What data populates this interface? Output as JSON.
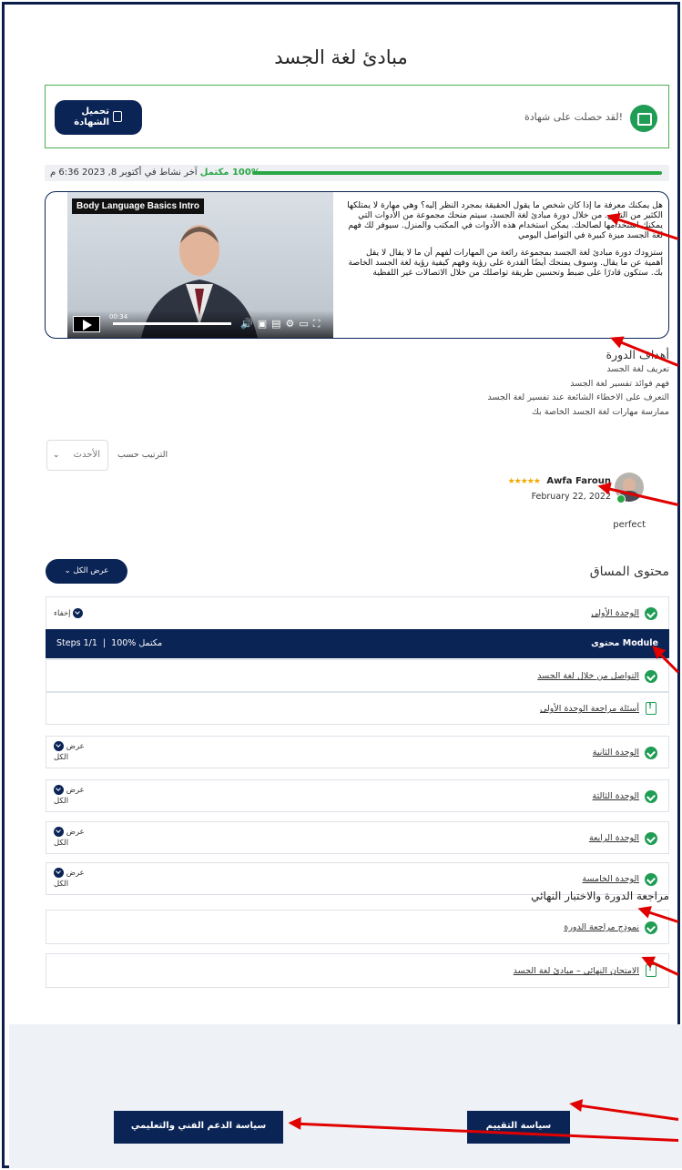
{
  "page": {
    "title": "مبادئ لغة الجسد"
  },
  "certificate": {
    "text": "لقد حصلت على شهادة!",
    "download_label": "تحميل الشهادة"
  },
  "progress": {
    "percent_label": "100% مكتمل",
    "activity": "آخر نشاط في أكتوبر 8, 2023 6:36 م",
    "value": 1.0
  },
  "intro": {
    "video_title": "Body Language Basics Intro",
    "time": "00:34",
    "paragraph1": "هل يمكنك معرفة ما إذا كان شخص ما يقول الحقيقة بمجرد النظر إليه؟ وهي مهارة لا يمتلكها الكثير من الناس. من خلال دورة مبادئ لغة الجسد، سيتم منحك مجموعة من الأدوات التي يمكنك استخدامها لصالحك. يمكن استخدام هذه الأدوات في المكتب والمنزل. سيوفر لك فهم لغة الجسد ميزة كبيرة في التواصل اليومي",
    "paragraph2": "ستزودك دورة مبادئ لغة الجسد بمجموعة رائعة من المهارات لفهم أن ما لا يقال لا يقل أهمية عن ما يقال. وسوف يمنحك أيضًا القدرة على رؤية وفهم كيفية رؤية لغة الجسد الخاصة بك. ستكون قادرًا على ضبط وتحسين طريقة تواصلك من خلال الاتصالات غير اللفظية"
  },
  "goals": {
    "title": "أهداف الدورة",
    "items": [
      "تعريف لغة الجسد",
      "فهم فوائد تفسير لغة الجسد",
      "التعرف على الاخطاء الشائعة عند تفسير لغة الجسد",
      "ممارسة مهارات لغة الجسد الخاصة بك"
    ]
  },
  "sort": {
    "label": "الترتيب حسب",
    "selected": "الأحدث"
  },
  "review": {
    "name": "Awfa Faroun",
    "stars": "★★★★★",
    "date": "February 22, 2022",
    "text": "perfect"
  },
  "content": {
    "title": "محتوى المساق",
    "expand_all": "عرض الكل",
    "collapse": "إخفاء",
    "show_all_short": "عرض الكل",
    "module_header": "محتوى Module",
    "module_progress": "100% مكتمل",
    "module_steps": "Steps 1/1",
    "units": [
      "الوحدة الأولى",
      "الوحدة الثانية",
      "الوحدة الثالثة",
      "الوحدة الرابعة",
      "الوحدة الخامسة"
    ],
    "lessons": [
      "التواصل من خلال لغة الجسد",
      "أسئلة مراجعة الوحدة الأولى"
    ]
  },
  "final": {
    "title": "مراجعة الدورة والاختبار النهائي",
    "review_model": "نموذج مراجعة الدورة",
    "final_exam": "الامتحان النهائي – مبادئ لغة الجسد"
  },
  "footer": {
    "assessment_policy": "سياسة التقييم",
    "support_policy": "سياسة الدعم الفني والتعليمي"
  }
}
